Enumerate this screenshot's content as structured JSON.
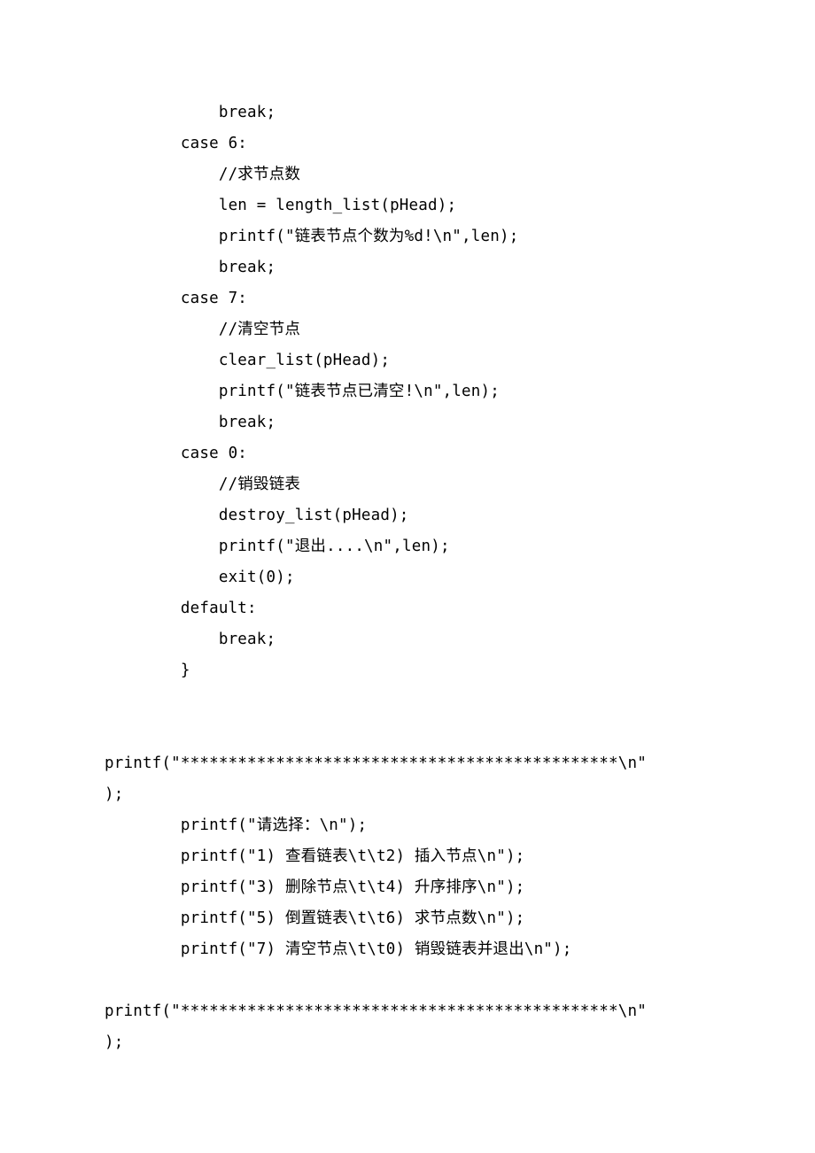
{
  "lines": [
    "            break;",
    "        case 6:",
    "            //求节点数",
    "            len = length_list(pHead);",
    "            printf(\"链表节点个数为%d!\\n\",len);",
    "            break;",
    "        case 7:",
    "            //清空节点",
    "            clear_list(pHead);",
    "            printf(\"链表节点已清空!\\n\",len);",
    "            break;",
    "        case 0:",
    "            //销毁链表",
    "            destroy_list(pHead);",
    "            printf(\"退出....\\n\",len);",
    "            exit(0);",
    "        default:",
    "            break;",
    "        }",
    "",
    "        ",
    "printf(\"**********************************************\\n\"",
    ");",
    "        printf(\"请选择：\\n\");",
    "        printf(\"1) 查看链表\\t\\t2) 插入节点\\n\");",
    "        printf(\"3) 删除节点\\t\\t4) 升序排序\\n\");",
    "        printf(\"5) 倒置链表\\t\\t6) 求节点数\\n\");",
    "        printf(\"7) 清空节点\\t\\t0) 销毁链表并退出\\n\");",
    "        ",
    "printf(\"**********************************************\\n\"",
    ");"
  ]
}
